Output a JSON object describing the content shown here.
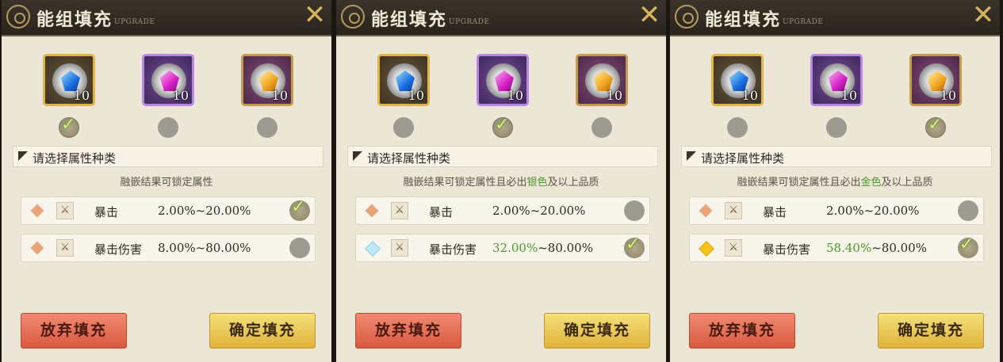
{
  "panels": [
    {
      "title": "能组填充",
      "subtitle": "UPGRADE",
      "gems": [
        {
          "icon": "blue-gem-icon",
          "count": "10",
          "selected": true
        },
        {
          "icon": "magenta-gem-icon",
          "count": "10",
          "selected": false
        },
        {
          "icon": "amber-gem-icon",
          "count": "10",
          "selected": false
        }
      ],
      "section_label": "请选择属性种类",
      "hint": {
        "prefix": "融嵌结果可锁定属性",
        "highlight": "",
        "suffix": ""
      },
      "attributes": [
        {
          "name": "暴击",
          "range_value": "",
          "range_text": "2.00%~20.00%",
          "selected": true
        },
        {
          "name": "暴击伤害",
          "range_value": "",
          "range_text": "8.00%~80.00%",
          "selected": false
        }
      ],
      "cancel_label": "放弃填充",
      "confirm_label": "确定填充"
    },
    {
      "title": "能组填充",
      "subtitle": "UPGRADE",
      "gems": [
        {
          "icon": "blue-gem-icon",
          "count": "10",
          "selected": false
        },
        {
          "icon": "magenta-gem-icon",
          "count": "10",
          "selected": true
        },
        {
          "icon": "amber-gem-icon",
          "count": "10",
          "selected": false
        }
      ],
      "section_label": "请选择属性种类",
      "hint": {
        "prefix": "融嵌结果可锁定属性且必出",
        "highlight": "银色",
        "suffix": "及以上品质"
      },
      "attributes": [
        {
          "name": "暴击",
          "range_value": "",
          "range_text": "2.00%~20.00%",
          "selected": false
        },
        {
          "name": "暴击伤害",
          "range_value": "32.00%",
          "range_text": "~80.00%",
          "selected": true
        }
      ],
      "cancel_label": "放弃填充",
      "confirm_label": "确定填充"
    },
    {
      "title": "能组填充",
      "subtitle": "UPGRADE",
      "gems": [
        {
          "icon": "blue-gem-icon",
          "count": "10",
          "selected": false
        },
        {
          "icon": "magenta-gem-icon",
          "count": "10",
          "selected": false
        },
        {
          "icon": "amber-gem-icon",
          "count": "10",
          "selected": true
        }
      ],
      "section_label": "请选择属性种类",
      "hint": {
        "prefix": "融嵌结果可锁定属性且必出",
        "highlight": "金色",
        "suffix": "及以上品质"
      },
      "attributes": [
        {
          "name": "暴击",
          "range_value": "",
          "range_text": "2.00%~20.00%",
          "selected": false
        },
        {
          "name": "暴击伤害",
          "range_value": "58.40%",
          "range_text": "~80.00%",
          "selected": true
        }
      ],
      "cancel_label": "放弃填充",
      "confirm_label": "确定填充"
    }
  ],
  "colors": {
    "accent_green": "#4a9a2a",
    "cancel": "#d9593f",
    "confirm": "#e0b23a",
    "title_bar": "#29241d"
  },
  "icons": {
    "close": "close-icon",
    "check": "check-icon",
    "sword": "sword-icon",
    "diamond": "quality-diamond-icon"
  }
}
